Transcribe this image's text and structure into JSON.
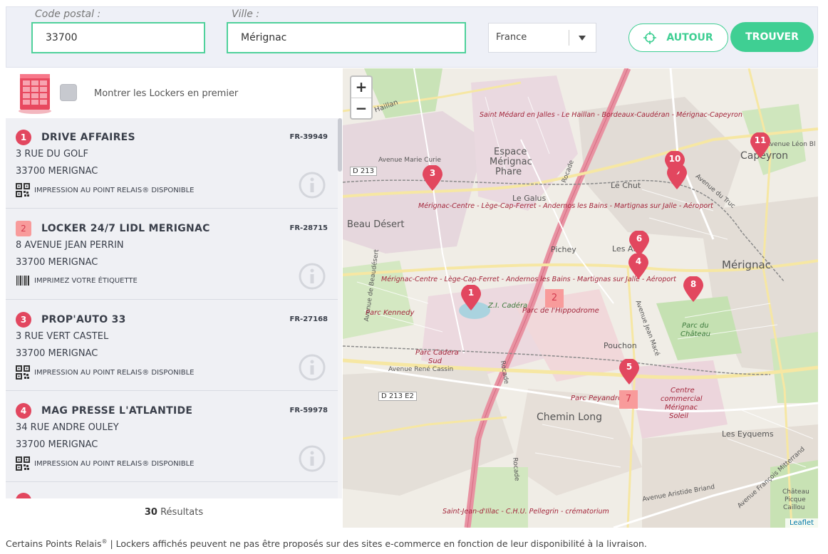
{
  "search": {
    "postal_label": "Code postal :",
    "postal_value": "33700",
    "city_label": "Ville :",
    "city_value": "Mérignac",
    "country": "France",
    "around_label": "AUTOUR",
    "find_label": "TROUVER"
  },
  "lockers_first_label": "Montrer les Lockers en premier",
  "results": [
    {
      "num": "1",
      "type": "relay",
      "name": "DRIVE AFFAIRES",
      "code": "FR-39949",
      "address": "3 RUE DU GOLF",
      "city": "33700 MERIGNAC",
      "service_icon": "qr-code-icon",
      "service": "IMPRESSION AU POINT RELAIS® DISPONIBLE"
    },
    {
      "num": "2",
      "type": "locker",
      "name": "LOCKER 24/7 LIDL MERIGNAC",
      "code": "FR-28715",
      "address": "8 AVENUE JEAN PERRIN",
      "city": "33700 MERIGNAC",
      "service_icon": "barcode-icon",
      "service": "IMPRIMEZ VOTRE ÉTIQUETTE"
    },
    {
      "num": "3",
      "type": "relay",
      "name": "PROP'AUTO 33",
      "code": "FR-27168",
      "address": "3 RUE VERT CASTEL",
      "city": "33700 MERIGNAC",
      "service_icon": "qr-code-icon",
      "service": "IMPRESSION AU POINT RELAIS® DISPONIBLE"
    },
    {
      "num": "4",
      "type": "relay",
      "name": "MAG PRESSE L'ATLANTIDE",
      "code": "FR-59978",
      "address": "34 RUE ANDRE OULEY",
      "city": "33700 MERIGNAC",
      "service_icon": "qr-code-icon",
      "service": "IMPRESSION AU POINT RELAIS® DISPONIBLE"
    }
  ],
  "results_count": "30",
  "results_word": "Résultats",
  "map": {
    "zoom_in": "+",
    "zoom_out": "−",
    "attribution": "Leaflet",
    "labels": {
      "espace": "Espace",
      "merignac_phare1": "Mérignac",
      "phare": "Phare",
      "le_galus": "Le Galus",
      "le_chut": "Le Chut",
      "beau_desert": "Beau Désert",
      "pichey": "Pichey",
      "les_arts": "Les Arts",
      "merignac": "Mérignac",
      "capeyron": "Capeyron",
      "pouchon": "Pouchon",
      "chemin_long": "Chemin Long",
      "les_eyquems": "Les Eyquems",
      "d213": "D 213",
      "d213e2": "D 213 E2",
      "ave_marie_curie": "Avenue Marie Curie",
      "ave_rene_cassin": "Avenue René Cassin",
      "ave_jean_mace": "Avenue Jean Macé",
      "ave_truc": "Avenue du Truc",
      "ave_leon_blum": "Avenue Léon Bl",
      "ave_beaudesert": "Avenue de Beaudésert",
      "ave_briand": "Avenue Aristide Briand",
      "ave_mitterrand": "Avenue François Mitterrand",
      "rocade": "Rocade",
      "haillan": "Haillan",
      "za_cadera": "Z.I. Cadéra",
      "parc_hippodrome": "Parc de l'Hippodrome",
      "parc_kennedy": "Parc Kennedy",
      "parc_cadera": "Parc Cadera",
      "sud": "Sud",
      "parc_peyandreau": "Parc Peyandreau",
      "centre_commercial": "Centre",
      "commercial": "commercial",
      "merignac_soleil1": "Mérignac",
      "soleil": "Soleil",
      "parc_chateau": "Parc du",
      "chateau": "Château",
      "chateau_picque": "Château",
      "picque": "Picque",
      "caillou": "Caillou",
      "tram_top": "Saint Médard en Jalles - Le Haillan - Bordeaux-Caudéran - Mérignac-Capeyron",
      "tram_mid": "Mérignac-Centre - Lège-Cap-Ferret - Andernos les Bains - Martignas sur Jalle - Aéroport",
      "tram_mid2": "Mérignac-Centre - Lège-Cap-Ferret - Andernos les Bains - Martignas sur Jalle - Aéroport",
      "tram_bottom": "Saint-Jean-d'Illac - C.H.U. Pellegrin - crématorium"
    },
    "pins": [
      "1",
      "3",
      "4",
      "5",
      "6",
      "8",
      "9",
      "10",
      "11"
    ],
    "lockers": [
      "2",
      "7"
    ]
  },
  "footer_text_a": "Certains Points Relais",
  "footer_reg": "®",
  "footer_text_b": " | Lockers affichés peuvent ne pas être proposés sur des sites e-commerce en fonction de leur disponibilité à la livraison."
}
